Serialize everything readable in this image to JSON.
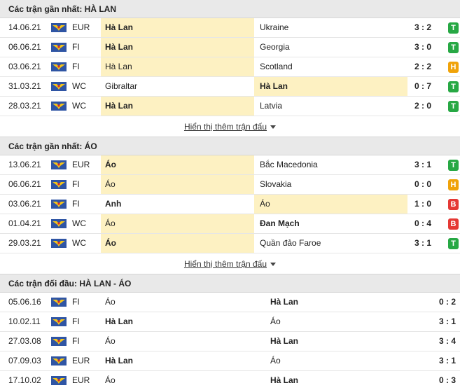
{
  "colors": {
    "win": "#27a844",
    "draw": "#f0a30a",
    "loss": "#e53935",
    "highlight": "#fdf1c2"
  },
  "sections": [
    {
      "title": "Các trận gần nhất: HÀ LAN",
      "more": "Hiển thị thêm trận đấu",
      "rows": [
        {
          "date": "14.06.21",
          "comp": "EUR",
          "home": "Hà Lan",
          "away": "Ukraine",
          "score": "3 : 2",
          "result": "T",
          "hl": "home",
          "bold": "home"
        },
        {
          "date": "06.06.21",
          "comp": "FI",
          "home": "Hà Lan",
          "away": "Georgia",
          "score": "3 : 0",
          "result": "T",
          "hl": "home",
          "bold": "home"
        },
        {
          "date": "03.06.21",
          "comp": "FI",
          "home": "Hà Lan",
          "away": "Scotland",
          "score": "2 : 2",
          "result": "H",
          "hl": "home",
          "bold": ""
        },
        {
          "date": "31.03.21",
          "comp": "WC",
          "home": "Gibraltar",
          "away": "Hà Lan",
          "score": "0 : 7",
          "result": "T",
          "hl": "away",
          "bold": "away"
        },
        {
          "date": "28.03.21",
          "comp": "WC",
          "home": "Hà Lan",
          "away": "Latvia",
          "score": "2 : 0",
          "result": "T",
          "hl": "home",
          "bold": "home"
        }
      ]
    },
    {
      "title": "Các trận gần nhất: ÁO",
      "more": "Hiển thị thêm trận đấu",
      "rows": [
        {
          "date": "13.06.21",
          "comp": "EUR",
          "home": "Áo",
          "away": "Bắc Macedonia",
          "score": "3 : 1",
          "result": "T",
          "hl": "home",
          "bold": "home"
        },
        {
          "date": "06.06.21",
          "comp": "FI",
          "home": "Áo",
          "away": "Slovakia",
          "score": "0 : 0",
          "result": "H",
          "hl": "home",
          "bold": ""
        },
        {
          "date": "03.06.21",
          "comp": "FI",
          "home": "Anh",
          "away": "Áo",
          "score": "1 : 0",
          "result": "B",
          "hl": "away",
          "bold": "home"
        },
        {
          "date": "01.04.21",
          "comp": "WC",
          "home": "Áo",
          "away": "Đan Mạch",
          "score": "0 : 4",
          "result": "B",
          "hl": "home",
          "bold": "away"
        },
        {
          "date": "29.03.21",
          "comp": "WC",
          "home": "Áo",
          "away": "Quần đảo Faroe",
          "score": "3 : 1",
          "result": "T",
          "hl": "home",
          "bold": "home"
        }
      ]
    }
  ],
  "h2h": {
    "title": "Các trận đối đầu: HÀ LAN - ÁO",
    "rows": [
      {
        "date": "05.06.16",
        "comp": "FI",
        "home": "Áo",
        "away": "Hà Lan",
        "score": "0 : 2",
        "bold": "away"
      },
      {
        "date": "10.02.11",
        "comp": "FI",
        "home": "Hà Lan",
        "away": "Áo",
        "score": "3 : 1",
        "bold": "home"
      },
      {
        "date": "27.03.08",
        "comp": "FI",
        "home": "Áo",
        "away": "Hà Lan",
        "score": "3 : 4",
        "bold": "away"
      },
      {
        "date": "07.09.03",
        "comp": "EUR",
        "home": "Hà Lan",
        "away": "Áo",
        "score": "3 : 1",
        "bold": "home"
      },
      {
        "date": "17.10.02",
        "comp": "EUR",
        "home": "Áo",
        "away": "Hà Lan",
        "score": "0 : 3",
        "bold": "away"
      }
    ]
  }
}
